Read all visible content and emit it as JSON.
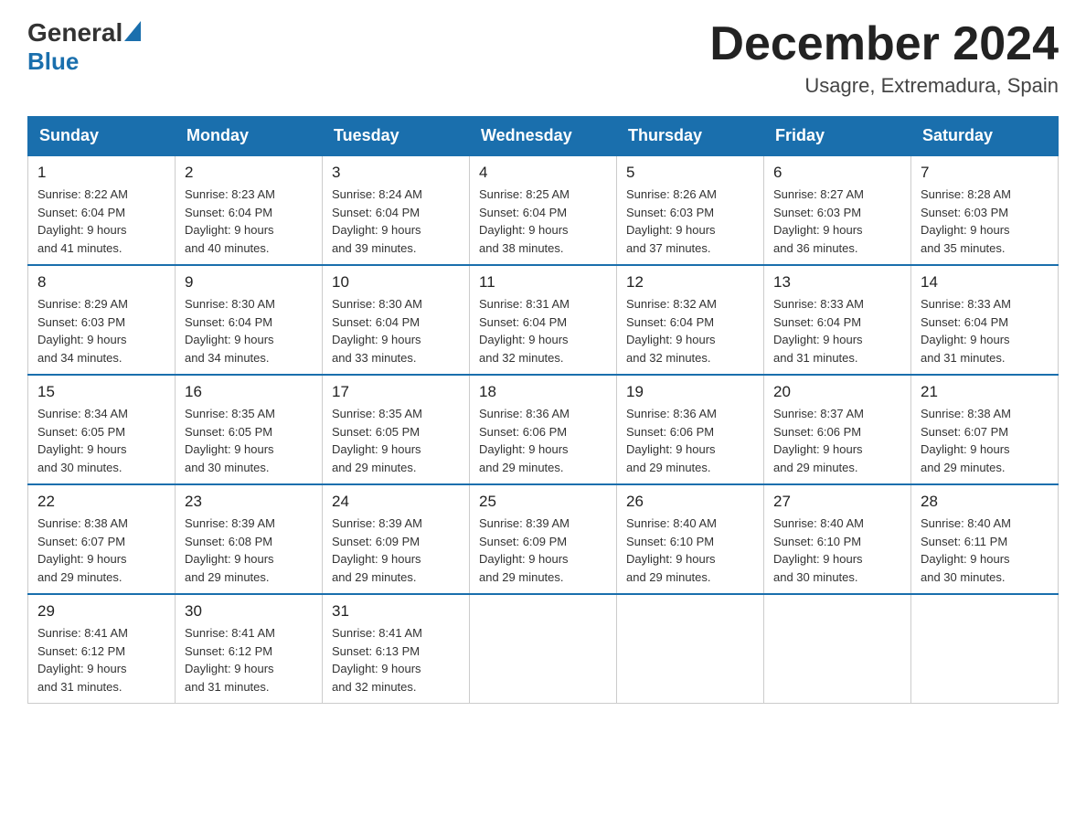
{
  "header": {
    "logo_general": "General",
    "logo_blue": "Blue",
    "month_title": "December 2024",
    "location": "Usagre, Extremadura, Spain"
  },
  "calendar": {
    "days_of_week": [
      "Sunday",
      "Monday",
      "Tuesday",
      "Wednesday",
      "Thursday",
      "Friday",
      "Saturday"
    ],
    "weeks": [
      [
        {
          "day": "1",
          "info": "Sunrise: 8:22 AM\nSunset: 6:04 PM\nDaylight: 9 hours\nand 41 minutes."
        },
        {
          "day": "2",
          "info": "Sunrise: 8:23 AM\nSunset: 6:04 PM\nDaylight: 9 hours\nand 40 minutes."
        },
        {
          "day": "3",
          "info": "Sunrise: 8:24 AM\nSunset: 6:04 PM\nDaylight: 9 hours\nand 39 minutes."
        },
        {
          "day": "4",
          "info": "Sunrise: 8:25 AM\nSunset: 6:04 PM\nDaylight: 9 hours\nand 38 minutes."
        },
        {
          "day": "5",
          "info": "Sunrise: 8:26 AM\nSunset: 6:03 PM\nDaylight: 9 hours\nand 37 minutes."
        },
        {
          "day": "6",
          "info": "Sunrise: 8:27 AM\nSunset: 6:03 PM\nDaylight: 9 hours\nand 36 minutes."
        },
        {
          "day": "7",
          "info": "Sunrise: 8:28 AM\nSunset: 6:03 PM\nDaylight: 9 hours\nand 35 minutes."
        }
      ],
      [
        {
          "day": "8",
          "info": "Sunrise: 8:29 AM\nSunset: 6:03 PM\nDaylight: 9 hours\nand 34 minutes."
        },
        {
          "day": "9",
          "info": "Sunrise: 8:30 AM\nSunset: 6:04 PM\nDaylight: 9 hours\nand 34 minutes."
        },
        {
          "day": "10",
          "info": "Sunrise: 8:30 AM\nSunset: 6:04 PM\nDaylight: 9 hours\nand 33 minutes."
        },
        {
          "day": "11",
          "info": "Sunrise: 8:31 AM\nSunset: 6:04 PM\nDaylight: 9 hours\nand 32 minutes."
        },
        {
          "day": "12",
          "info": "Sunrise: 8:32 AM\nSunset: 6:04 PM\nDaylight: 9 hours\nand 32 minutes."
        },
        {
          "day": "13",
          "info": "Sunrise: 8:33 AM\nSunset: 6:04 PM\nDaylight: 9 hours\nand 31 minutes."
        },
        {
          "day": "14",
          "info": "Sunrise: 8:33 AM\nSunset: 6:04 PM\nDaylight: 9 hours\nand 31 minutes."
        }
      ],
      [
        {
          "day": "15",
          "info": "Sunrise: 8:34 AM\nSunset: 6:05 PM\nDaylight: 9 hours\nand 30 minutes."
        },
        {
          "day": "16",
          "info": "Sunrise: 8:35 AM\nSunset: 6:05 PM\nDaylight: 9 hours\nand 30 minutes."
        },
        {
          "day": "17",
          "info": "Sunrise: 8:35 AM\nSunset: 6:05 PM\nDaylight: 9 hours\nand 29 minutes."
        },
        {
          "day": "18",
          "info": "Sunrise: 8:36 AM\nSunset: 6:06 PM\nDaylight: 9 hours\nand 29 minutes."
        },
        {
          "day": "19",
          "info": "Sunrise: 8:36 AM\nSunset: 6:06 PM\nDaylight: 9 hours\nand 29 minutes."
        },
        {
          "day": "20",
          "info": "Sunrise: 8:37 AM\nSunset: 6:06 PM\nDaylight: 9 hours\nand 29 minutes."
        },
        {
          "day": "21",
          "info": "Sunrise: 8:38 AM\nSunset: 6:07 PM\nDaylight: 9 hours\nand 29 minutes."
        }
      ],
      [
        {
          "day": "22",
          "info": "Sunrise: 8:38 AM\nSunset: 6:07 PM\nDaylight: 9 hours\nand 29 minutes."
        },
        {
          "day": "23",
          "info": "Sunrise: 8:39 AM\nSunset: 6:08 PM\nDaylight: 9 hours\nand 29 minutes."
        },
        {
          "day": "24",
          "info": "Sunrise: 8:39 AM\nSunset: 6:09 PM\nDaylight: 9 hours\nand 29 minutes."
        },
        {
          "day": "25",
          "info": "Sunrise: 8:39 AM\nSunset: 6:09 PM\nDaylight: 9 hours\nand 29 minutes."
        },
        {
          "day": "26",
          "info": "Sunrise: 8:40 AM\nSunset: 6:10 PM\nDaylight: 9 hours\nand 29 minutes."
        },
        {
          "day": "27",
          "info": "Sunrise: 8:40 AM\nSunset: 6:10 PM\nDaylight: 9 hours\nand 30 minutes."
        },
        {
          "day": "28",
          "info": "Sunrise: 8:40 AM\nSunset: 6:11 PM\nDaylight: 9 hours\nand 30 minutes."
        }
      ],
      [
        {
          "day": "29",
          "info": "Sunrise: 8:41 AM\nSunset: 6:12 PM\nDaylight: 9 hours\nand 31 minutes."
        },
        {
          "day": "30",
          "info": "Sunrise: 8:41 AM\nSunset: 6:12 PM\nDaylight: 9 hours\nand 31 minutes."
        },
        {
          "day": "31",
          "info": "Sunrise: 8:41 AM\nSunset: 6:13 PM\nDaylight: 9 hours\nand 32 minutes."
        },
        {
          "day": "",
          "info": ""
        },
        {
          "day": "",
          "info": ""
        },
        {
          "day": "",
          "info": ""
        },
        {
          "day": "",
          "info": ""
        }
      ]
    ]
  }
}
